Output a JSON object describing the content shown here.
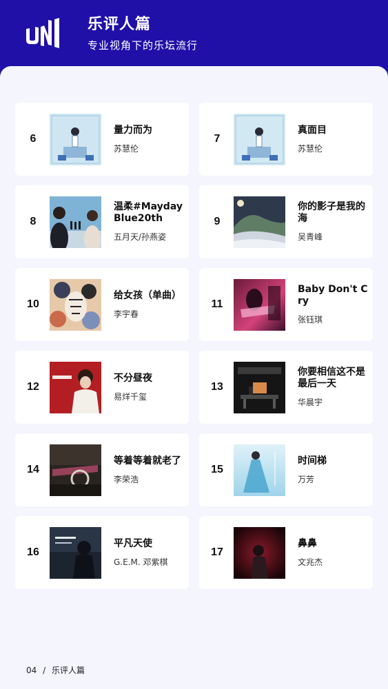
{
  "header": {
    "title": "乐评人篇",
    "subtitle": "专业视角下的乐坛流行",
    "logo_text": "UNI",
    "bg_color": "#2010a8"
  },
  "songs": [
    {
      "rank": "6",
      "title": "量力而为",
      "artist": "苏慧伦"
    },
    {
      "rank": "7",
      "title": "真面目",
      "artist": "苏慧伦"
    },
    {
      "rank": "8",
      "title": "温柔#Mayday Blue20th",
      "artist": "五月天/孙燕姿"
    },
    {
      "rank": "9",
      "title": "你的影子是我的海",
      "artist": "吴青峰"
    },
    {
      "rank": "10",
      "title": "给女孩（单曲）",
      "artist": "李宇春"
    },
    {
      "rank": "11",
      "title": "Baby Don't Cry",
      "artist": "张钰琪"
    },
    {
      "rank": "12",
      "title": "不分昼夜",
      "artist": "易烊千玺"
    },
    {
      "rank": "13",
      "title": "你要相信这不是最后一天",
      "artist": "华晨宇"
    },
    {
      "rank": "14",
      "title": "等着等着就老了",
      "artist": "李荣浩"
    },
    {
      "rank": "15",
      "title": "时间梯",
      "artist": "万芳"
    },
    {
      "rank": "16",
      "title": "平凡天使",
      "artist": "G.E.M. 邓紫棋"
    },
    {
      "rank": "17",
      "title": "鼻鼻",
      "artist": "文兆杰"
    }
  ],
  "footer": {
    "page": "04",
    "separator": "/",
    "section": "乐评人篇"
  }
}
